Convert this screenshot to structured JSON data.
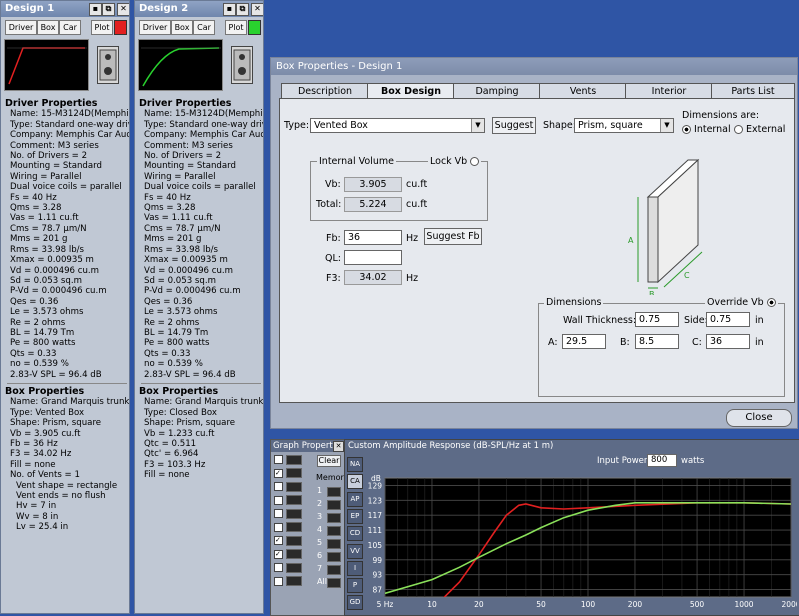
{
  "design1": {
    "title": "Design 1",
    "toolbar": [
      "Driver",
      "Box",
      "Car",
      "Plot"
    ],
    "plot_color": "#e22020",
    "driver_header": "Driver Properties",
    "driver_lines": [
      "Name: 15-M3124D(Memphis",
      "Type: Standard one-way driv",
      "Company: Memphis Car Aud",
      "Comment: M3 series",
      "No. of Drivers = 2",
      "Mounting = Standard",
      "Wiring = Parallel",
      "Dual voice coils = parallel",
      "Fs = 40 Hz",
      "Qms = 3.28",
      "Vas = 1.11 cu.ft",
      "Cms = 78.7 µm/N",
      "Mms = 201 g",
      "Rms = 33.98 lb/s",
      "Xmax = 0.00935 m",
      "Vd = 0.000496 cu.m",
      "Sd = 0.053 sq.m",
      "P-Vd = 0.000496 cu.m",
      "Qes = 0.36",
      "Le = 3.573 ohms",
      "Re = 2 ohms",
      "BL = 14.79 Tm",
      "Pe = 800 watts",
      "Qts = 0.33",
      "no = 0.539 %",
      "2.83-V SPL = 96.4 dB"
    ],
    "box_header": "Box Properties",
    "box_lines": [
      "Name: Grand Marquis trunk s",
      "Type: Vented Box",
      "Shape: Prism, square",
      "Vb = 3.905 cu.ft",
      "Fb = 36 Hz",
      "F3 = 34.02 Hz",
      "Fill = none",
      "No. of Vents = 1"
    ],
    "vent_lines": [
      "Vent shape = rectangle",
      "Vent ends = no flush",
      "Hv = 7 in",
      "Wv = 8 in",
      "Lv = 25.4 in"
    ]
  },
  "design2": {
    "title": "Design 2",
    "toolbar": [
      "Driver",
      "Box",
      "Car",
      "Plot"
    ],
    "plot_color": "#29d12e",
    "driver_header": "Driver Properties",
    "driver_lines": [
      "Name: 15-M3124D(Memphis",
      "Type: Standard one-way driv",
      "Company: Memphis Car Aud",
      "Comment: M3 series",
      "No. of Drivers = 2",
      "Mounting = Standard",
      "Wiring = Parallel",
      "Dual voice coils = parallel",
      "Fs = 40 Hz",
      "Qms = 3.28",
      "Vas = 1.11 cu.ft",
      "Cms = 78.7 µm/N",
      "Mms = 201 g",
      "Rms = 33.98 lb/s",
      "Xmax = 0.00935 m",
      "Vd = 0.000496 cu.m",
      "Sd = 0.053 sq.m",
      "P-Vd = 0.000496 cu.m",
      "Qes = 0.36",
      "Le = 3.573 ohms",
      "Re = 2 ohms",
      "BL = 14.79 Tm",
      "Pe = 800 watts",
      "Qts = 0.33",
      "no = 0.539 %",
      "2.83-V SPL = 96.4 dB"
    ],
    "box_header": "Box Properties",
    "box_lines": [
      "Name: Grand Marquis trunk s",
      "Type: Closed Box",
      "Shape: Prism, square",
      "Vb = 1.233 cu.ft",
      "Qtc = 0.511",
      "Qtc' = 6.964",
      "F3 = 103.3 Hz",
      "Fill = none"
    ]
  },
  "boxdlg": {
    "title": "Box Properties - Design 1",
    "tabs": [
      "Description",
      "Box Design",
      "Damping",
      "Vents",
      "Interior",
      "Parts List"
    ],
    "active_tab": "Box Design",
    "type_label": "Type:",
    "type_value": "Vented Box",
    "suggest": "Suggest",
    "shape_label": "Shape:",
    "shape_value": "Prism, square",
    "dims_are": "Dimensions are:",
    "internal": "Internal",
    "external": "External",
    "internal_volume": "Internal Volume",
    "lock_vb": "Lock Vb",
    "vb_label": "Vb:",
    "vb_value": "3.905",
    "vb_unit": "cu.ft",
    "total_label": "Total:",
    "total_value": "5.224",
    "total_unit": "cu.ft",
    "fb_label": "Fb:",
    "fb_value": "36",
    "fb_unit": "Hz",
    "suggest_fb": "Suggest Fb",
    "ql_label": "QL:",
    "f3_label": "F3:",
    "f3_value": "34.02",
    "f3_unit": "Hz",
    "dimensions": "Dimensions",
    "override_vb": "Override Vb",
    "wall_label": "Wall Thickness:",
    "wall_value": "0.75",
    "side_label": "Side:",
    "side_value": "0.75",
    "side_unit": "in",
    "a_label": "A:",
    "a_value": "29.5",
    "b_label": "B:",
    "b_value": "8.5",
    "c_label": "C:",
    "c_value": "36",
    "c_unit": "in",
    "close": "Close",
    "diagram_labels": [
      "A",
      "B",
      "C"
    ]
  },
  "graph_props": {
    "title": "Graph Properties",
    "clear": "Clear",
    "memory": "Memory",
    "mem_slots": [
      "1",
      "2",
      "3",
      "4",
      "5",
      "6",
      "7",
      "All"
    ]
  },
  "amplitude": {
    "title": "Custom Amplitude Response (dB-SPL/Hz at 1 m)",
    "input_power_label": "Input Power:",
    "input_power_value": "800",
    "input_power_unit": "watts",
    "side_buttons": [
      "NA",
      "CA",
      "AP",
      "EP",
      "CD",
      "VV",
      "I",
      "P",
      "GD"
    ],
    "active_side": "CA",
    "y_unit": "dB",
    "y_ticks": [
      "129",
      "123",
      "117",
      "111",
      "105",
      "99",
      "93",
      "87"
    ],
    "x_ticks": [
      "5 Hz",
      "10",
      "20",
      "50",
      "100",
      "200",
      "500",
      "1000",
      "2000"
    ]
  },
  "chart_data": {
    "type": "line",
    "title": "Custom Amplitude Response (dB-SPL/Hz at 1 m)",
    "xlabel": "",
    "ylabel": "dB",
    "xscale": "log",
    "xlim": [
      5,
      2000
    ],
    "ylim": [
      84,
      132
    ],
    "grid": true,
    "series": [
      {
        "color": "#e02020",
        "x": [
          5,
          10,
          15,
          20,
          25,
          30,
          36,
          40,
          50,
          70,
          100,
          200,
          500,
          1000,
          2000
        ],
        "y": [
          69,
          79,
          90,
          101,
          110,
          117,
          121,
          121.5,
          120,
          119.5,
          120,
          121,
          122,
          122,
          121.5
        ]
      },
      {
        "color": "#8ae05a",
        "x": [
          5,
          10,
          15,
          20,
          30,
          40,
          50,
          70,
          100,
          150,
          200,
          500,
          1000,
          2000
        ],
        "y": [
          85.5,
          91,
          96,
          100,
          105.5,
          109,
          112,
          116,
          119,
          121,
          122,
          122,
          122,
          121.5
        ]
      }
    ]
  }
}
